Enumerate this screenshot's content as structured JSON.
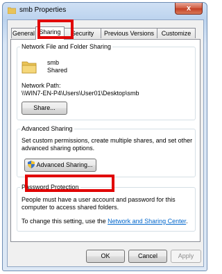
{
  "window": {
    "title": "smb Properties",
    "close_glyph": "x",
    "icon": "folder-icon"
  },
  "tabs": [
    {
      "label": "General"
    },
    {
      "label": "Sharing"
    },
    {
      "label": "Security"
    },
    {
      "label": "Previous Versions"
    },
    {
      "label": "Customize"
    }
  ],
  "network_sharing": {
    "group_title": "Network File and Folder Sharing",
    "folder_name": "smb",
    "folder_status": "Shared",
    "path_label": "Network Path:",
    "path_value": "\\\\WIN7-EN-P4\\Users\\User01\\Desktop\\smb",
    "share_button": "Share..."
  },
  "advanced_sharing": {
    "group_title": "Advanced Sharing",
    "description_line1": "Set custom permissions, create multiple shares, and set other",
    "description_line2": "advanced sharing options.",
    "button_label": "Advanced Sharing..."
  },
  "password_protection": {
    "group_title": "Password Protection",
    "line1": "People must have a user account and password for this",
    "line2": "computer to access shared folders.",
    "line3_prefix": "To change this setting, use the ",
    "link_text": "Network and Sharing Center",
    "line3_suffix": "."
  },
  "footer": {
    "ok": "OK",
    "cancel": "Cancel",
    "apply": "Apply"
  },
  "colors": {
    "highlight": "#e10000",
    "link": "#0066cc"
  }
}
